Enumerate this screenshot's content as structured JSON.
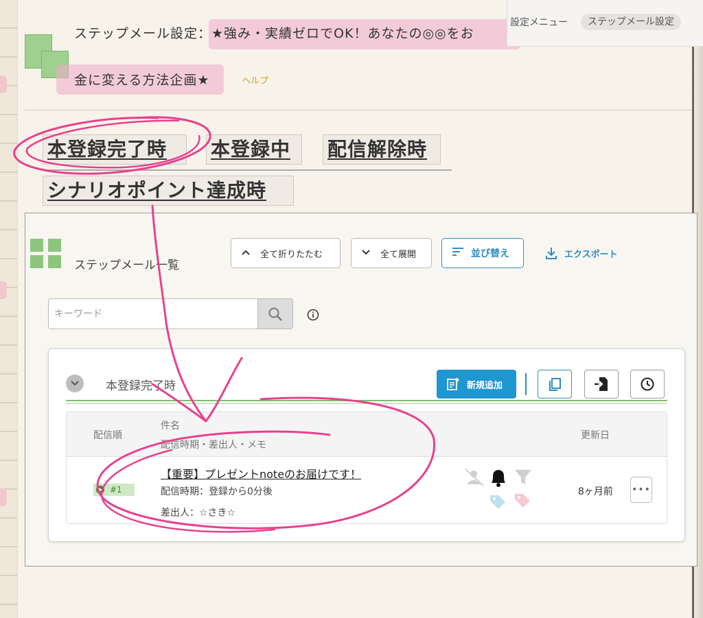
{
  "header": {
    "title_prefix": "ステップメール設定：",
    "title_rest": "★強み・実績ゼロでOK！あなたの◎◎をお",
    "title_line2": "金に変える方法企画★",
    "help_label": "ヘルプ"
  },
  "settings_menu": {
    "label": "設定メニュー",
    "selected": "ステップメール設定"
  },
  "tabs": [
    {
      "label": "本登録完了時"
    },
    {
      "label": "本登録中"
    },
    {
      "label": "配信解除時"
    },
    {
      "label": "シナリオポイント達成時"
    }
  ],
  "list": {
    "title": "ステップメール一覧",
    "collapse_all_label": "全て折りたたむ",
    "expand_all_label": "全て展開",
    "sort_label": "並び替え",
    "export_label": "エクスポート",
    "search_placeholder": "キーワード"
  },
  "section": {
    "title": "本登録完了時",
    "add_label": "新規追加"
  },
  "table": {
    "col_order": "配信順",
    "col_subject": "件名",
    "col_subject_sub": "配信時期・差出人・メモ",
    "col_updated": "更新日",
    "rows": [
      {
        "order": "#1",
        "subject": "【重要】プレゼントnoteのお届けです！",
        "timing": "配信時期：登録から0分後",
        "sender": "差出人：☆さき☆",
        "updated": "8ヶ月前"
      }
    ]
  },
  "colors": {
    "accent": "#1e96d0",
    "annotation": "#e83e8c",
    "green": "#8cc57c"
  }
}
